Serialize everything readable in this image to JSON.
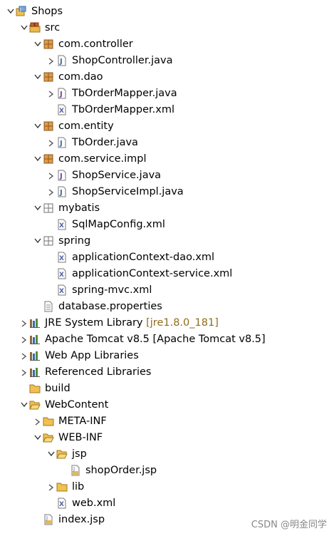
{
  "tree": [
    {
      "label": "Shops",
      "level": 0,
      "expanded": true,
      "icon": "project-icon"
    },
    {
      "label": "src",
      "level": 1,
      "expanded": true,
      "icon": "source-folder-icon"
    },
    {
      "label": "com.controller",
      "level": 2,
      "expanded": true,
      "icon": "package-icon"
    },
    {
      "label": "ShopController.java",
      "level": 3,
      "expanded": false,
      "icon": "java-file-icon"
    },
    {
      "label": "com.dao",
      "level": 2,
      "expanded": true,
      "icon": "package-icon"
    },
    {
      "label": "TbOrderMapper.java",
      "level": 3,
      "expanded": false,
      "icon": "java-interface-icon"
    },
    {
      "label": "TbOrderMapper.xml",
      "level": 3,
      "icon": "xml-file-icon"
    },
    {
      "label": "com.entity",
      "level": 2,
      "expanded": true,
      "icon": "package-icon"
    },
    {
      "label": "TbOrder.java",
      "level": 3,
      "expanded": false,
      "icon": "java-file-icon"
    },
    {
      "label": "com.service.impl",
      "level": 2,
      "expanded": true,
      "icon": "package-icon"
    },
    {
      "label": "ShopService.java",
      "level": 3,
      "expanded": false,
      "icon": "java-interface-icon"
    },
    {
      "label": "ShopServiceImpl.java",
      "level": 3,
      "expanded": false,
      "icon": "java-file-icon"
    },
    {
      "label": "mybatis",
      "level": 2,
      "expanded": true,
      "icon": "empty-package-icon"
    },
    {
      "label": "SqlMapConfig.xml",
      "level": 3,
      "icon": "xml-file-icon"
    },
    {
      "label": "spring",
      "level": 2,
      "expanded": true,
      "icon": "empty-package-icon"
    },
    {
      "label": "applicationContext-dao.xml",
      "level": 3,
      "icon": "xml-file-icon"
    },
    {
      "label": "applicationContext-service.xml",
      "level": 3,
      "icon": "xml-file-icon"
    },
    {
      "label": "spring-mvc.xml",
      "level": 3,
      "icon": "xml-file-icon"
    },
    {
      "label": "database.properties",
      "level": 2,
      "icon": "properties-file-icon"
    },
    {
      "label": "JRE System Library",
      "decoration": " [jre1.8.0_181]",
      "level": 1,
      "expanded": false,
      "icon": "library-icon"
    },
    {
      "label": "Apache Tomcat v8.5 [Apache Tomcat v8.5]",
      "level": 1,
      "expanded": false,
      "icon": "library-icon"
    },
    {
      "label": "Web App Libraries",
      "level": 1,
      "expanded": false,
      "icon": "library-icon"
    },
    {
      "label": "Referenced Libraries",
      "level": 1,
      "expanded": false,
      "icon": "library-icon"
    },
    {
      "label": "build",
      "level": 1,
      "icon": "folder-icon"
    },
    {
      "label": "WebContent",
      "level": 1,
      "expanded": true,
      "icon": "open-folder-icon"
    },
    {
      "label": "META-INF",
      "level": 2,
      "expanded": false,
      "icon": "folder-icon"
    },
    {
      "label": "WEB-INF",
      "level": 2,
      "expanded": true,
      "icon": "open-folder-icon"
    },
    {
      "label": "jsp",
      "level": 3,
      "expanded": true,
      "icon": "open-folder-icon"
    },
    {
      "label": "shopOrder.jsp",
      "level": 4,
      "icon": "jsp-file-icon"
    },
    {
      "label": "lib",
      "level": 3,
      "expanded": false,
      "icon": "folder-icon"
    },
    {
      "label": "web.xml",
      "level": 3,
      "icon": "xml-file-icon"
    },
    {
      "label": "index.jsp",
      "level": 2,
      "icon": "jsp-file-icon"
    }
  ],
  "watermark": "CSDN @明金同学",
  "colors": {
    "decoration": "#8f6c1a",
    "folder": "#e8b84a",
    "package": "#b07d2a"
  }
}
